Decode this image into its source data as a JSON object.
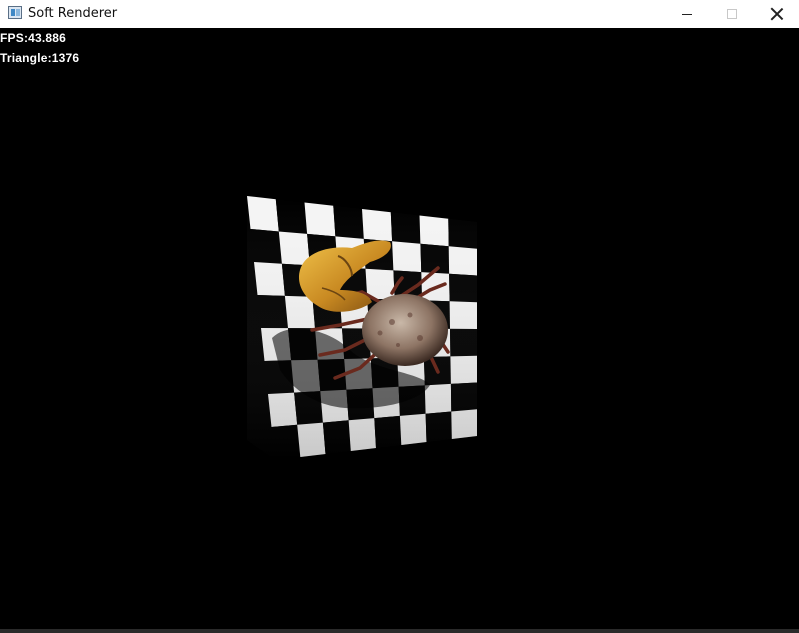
{
  "window": {
    "title": "Soft Renderer",
    "icon": "app-window-icon",
    "controls": [
      "minimize-icon",
      "maximize-icon",
      "close-icon"
    ]
  },
  "hud": {
    "fps": "FPS:43.886",
    "triangles": "Triangle:1376"
  },
  "scene": {
    "background_color": "#000000",
    "checker_light": "#f4f4f4",
    "checker_dark": "#000000",
    "model_claw_color": "#d29a2a",
    "model_body_color": "#9a8170",
    "model_legs_color": "#6a2a1e"
  }
}
